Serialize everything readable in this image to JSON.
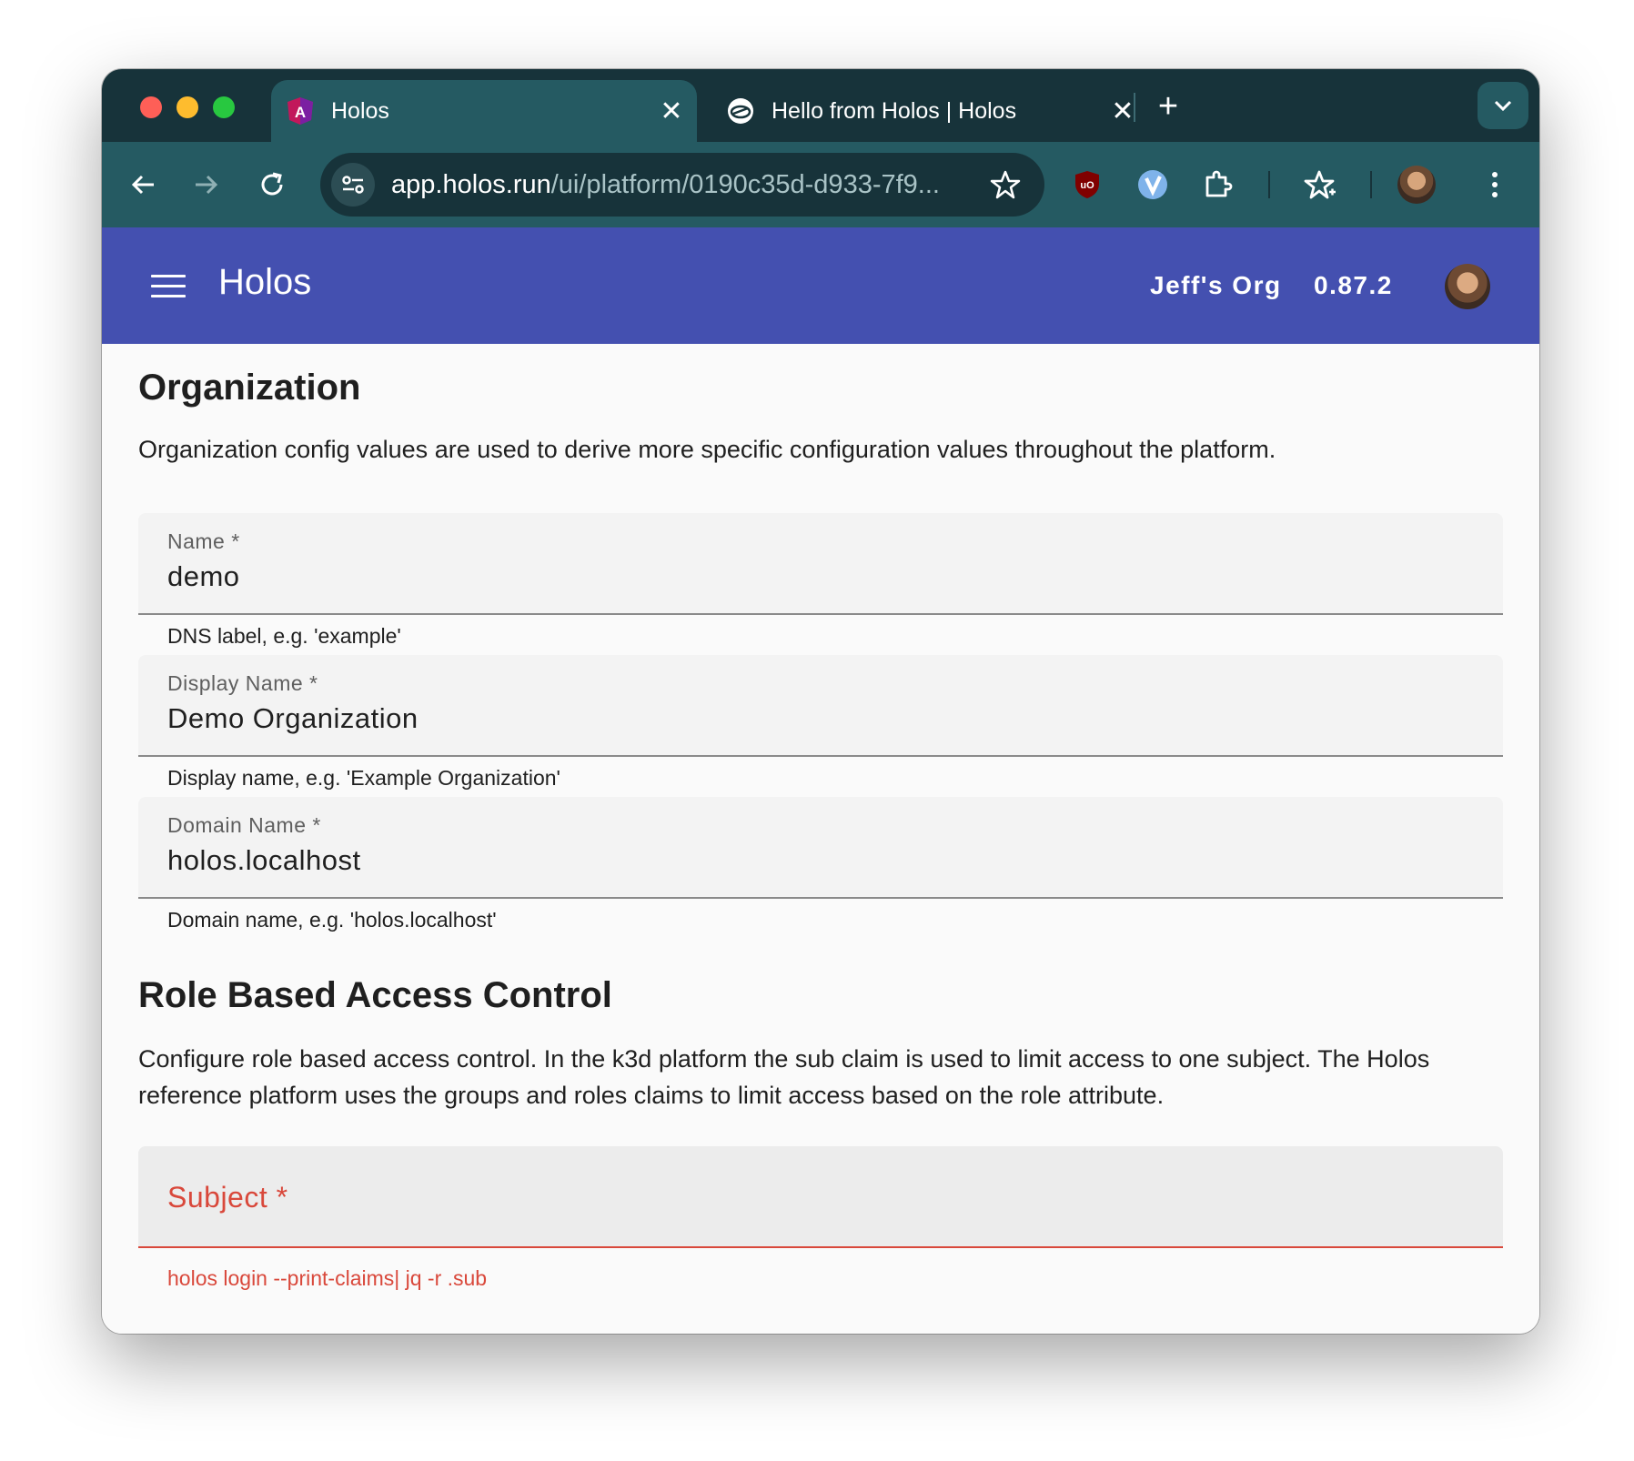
{
  "browser": {
    "tabs": [
      {
        "title": "Holos",
        "active": true,
        "favicon": "angular-icon"
      },
      {
        "title": "Hello from Holos | Holos",
        "active": false,
        "favicon": "holos-favicon-icon"
      }
    ],
    "url_host": "app.holos.run",
    "url_path": "/ui/platform/0190c35d-d933-7f9...",
    "colors": {
      "tabstrip": "#17333a",
      "toolbar": "#255a62",
      "omnibox": "#17333a"
    }
  },
  "appbar": {
    "title": "Holos",
    "org": "Jeff's Org",
    "version": "0.87.2",
    "color": "#4450b0"
  },
  "organization": {
    "title": "Organization",
    "description": "Organization config values are used to derive more specific configuration values throughout the platform.",
    "fields": [
      {
        "label": "Name *",
        "value": "demo",
        "hint": "DNS label, e.g. 'example'"
      },
      {
        "label": "Display Name *",
        "value": "Demo Organization",
        "hint": "Display name, e.g. 'Example Organization'"
      },
      {
        "label": "Domain Name *",
        "value": "holos.localhost",
        "hint": "Domain name, e.g. 'holos.localhost'"
      }
    ]
  },
  "rbac": {
    "title": "Role Based Access Control",
    "description": "Configure role based access control. In the k3d platform the sub claim is used to limit access to one subject. The Holos reference platform uses the groups and roles claims to limit access based on the role attribute.",
    "subject": {
      "label": "Subject *",
      "value": "",
      "hint": "holos login --print-claims| jq -r .sub"
    },
    "error_color": "#d9483b"
  }
}
